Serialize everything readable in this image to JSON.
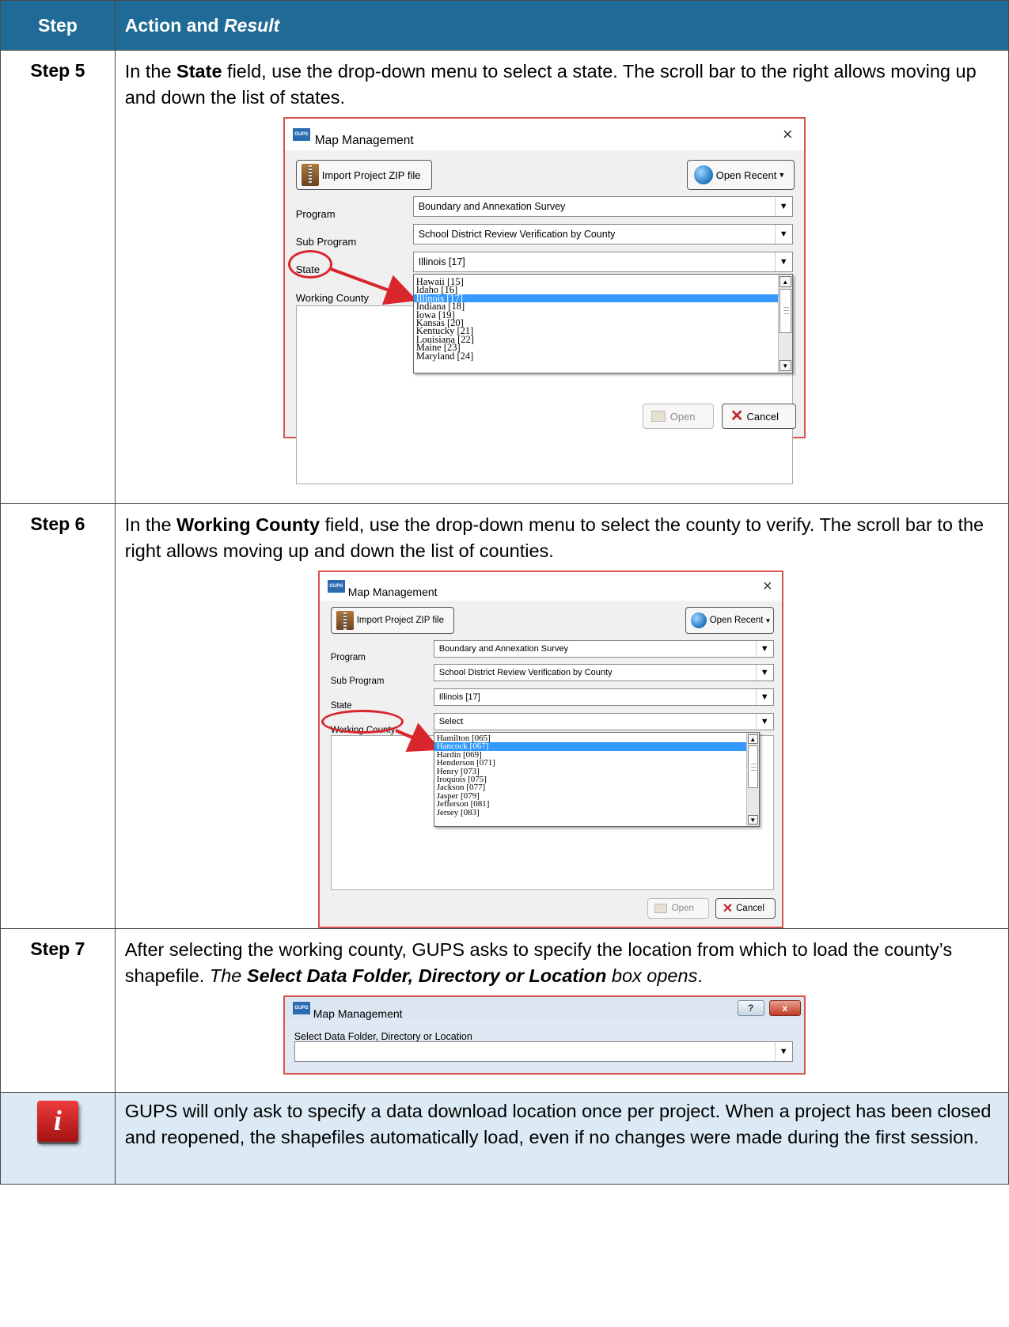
{
  "header": {
    "step_label": "Step",
    "action_label": "Action and ",
    "result_label": "Result"
  },
  "steps": [
    {
      "label": "Step 5",
      "text_pre": "In the ",
      "text_bold": "State",
      "text_post": " field, use the drop-down menu to select a state. The scroll bar to the right allows moving up and down the list of states.",
      "dialog": {
        "icon_text": "GUPS",
        "title": "Map Management",
        "import_button": "Import Project ZIP file",
        "open_recent_button": "Open Recent",
        "program_label": "Program",
        "program_value": "Boundary and Annexation Survey",
        "subprogram_label": "Sub Program",
        "subprogram_value": "School District Review Verification by County",
        "state_label": "State",
        "state_value": "Illinois [17]",
        "county_label": "Working County",
        "dropdown_items": [
          "Hawaii [15]",
          "Idaho [16]",
          "Illinois [17]",
          "Indiana [18]",
          "Iowa [19]",
          "Kansas [20]",
          "Kentucky [21]",
          "Louisiana [22]",
          "Maine [23]",
          "Maryland [24]"
        ],
        "selected_index": 2,
        "open_button": "Open",
        "cancel_button": "Cancel"
      }
    },
    {
      "label": "Step 6",
      "text_pre": "In the ",
      "text_bold": "Working County",
      "text_post": " field, use the drop-down menu to select the county to verify. The scroll bar to the right allows moving up and down the list of counties.",
      "dialog": {
        "icon_text": "GUPS",
        "title": "Map Management",
        "import_button": "Import Project ZIP file",
        "open_recent_button": "Open Recent",
        "program_label": "Program",
        "program_value": "Boundary and Annexation Survey",
        "subprogram_label": "Sub Program",
        "subprogram_value": "School District Review Verification by County",
        "state_label": "State",
        "state_value": "Illinois [17]",
        "county_label": "Working County",
        "county_value": "Select",
        "dropdown_items": [
          "Hamilton [065]",
          "Hancock [067]",
          "Hardin [069]",
          "Henderson [071]",
          "Henry [073]",
          "Iroquois [075]",
          "Jackson [077]",
          "Jasper [079]",
          "Jefferson [081]",
          "Jersey [083]"
        ],
        "selected_index": 1,
        "open_button": "Open",
        "cancel_button": "Cancel"
      }
    },
    {
      "label": "Step 7",
      "text_pre": "After selecting the working county, GUPS asks to specify the location from which to load the county’s shapefile. ",
      "text_italic_1": "The ",
      "text_bold_italic": "Select Data Folder, Directory or Location",
      "text_italic_2": " box opens",
      "text_end": ".",
      "dialog": {
        "icon_text": "GUPS",
        "title": "Map Management",
        "help_button": "?",
        "close_button": "x",
        "field_label": "Select Data Folder, Directory or Location",
        "field_value": ""
      }
    }
  ],
  "note": {
    "icon_letter": "i",
    "text": "GUPS will only ask to specify a data download location once per project. When a project has been closed and reopened, the shapefiles automatically load, even if no changes were made during the first session."
  },
  "colors": {
    "header_bg": "#1f6a96",
    "note_bg": "#dbeaf4",
    "selection": "#3399ff",
    "annotation_red": "#d9262c"
  }
}
